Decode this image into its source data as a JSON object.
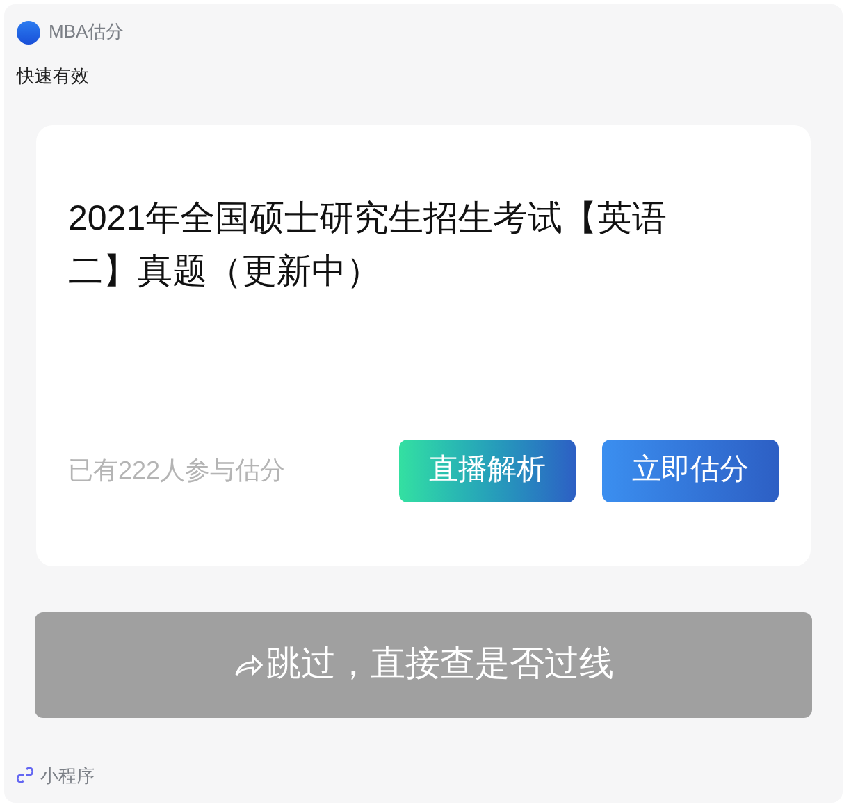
{
  "header": {
    "name": "MBA估分"
  },
  "description": "快速有效",
  "card": {
    "title": "2021年全国硕士研究生招生考试【英语二】真题（更新中）",
    "participants": "已有222人参与估分",
    "buttons": [
      {
        "label": "直播解析",
        "kind": "live"
      },
      {
        "label": "立即估分",
        "kind": "estimate"
      }
    ]
  },
  "skip_button": {
    "label": "跳过，直接查是否过线"
  },
  "footer": {
    "label": "小程序"
  }
}
